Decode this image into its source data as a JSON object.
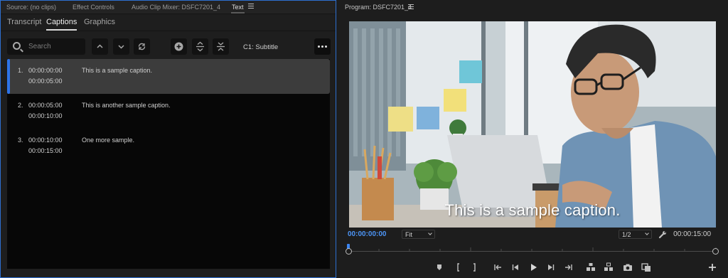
{
  "left_panel": {
    "tabs": [
      {
        "label": "Source: (no clips)"
      },
      {
        "label": "Effect Controls"
      },
      {
        "label": "Audio Clip Mixer: DSFC7201_4"
      },
      {
        "label": "Text"
      }
    ],
    "active_tab": "Text",
    "sub_tabs": [
      {
        "label": "Transcript"
      },
      {
        "label": "Captions"
      },
      {
        "label": "Graphics"
      }
    ],
    "active_sub_tab": "Captions",
    "search": {
      "placeholder": "Search",
      "value": ""
    },
    "track_label": "C1: Subtitle",
    "captions": [
      {
        "num": "1.",
        "in": "00:00:00:00",
        "out": "00:00:05:00",
        "text": "This is a sample caption.",
        "selected": true
      },
      {
        "num": "2.",
        "in": "00:00:05:00",
        "out": "00:00:10:00",
        "text": "This is another sample caption.",
        "selected": false
      },
      {
        "num": "3.",
        "in": "00:00:10:00",
        "out": "00:00:15:00",
        "text": "One more sample.",
        "selected": false
      }
    ]
  },
  "program": {
    "title": "Program: DSFC7201_4",
    "caption_overlay": "This is a sample caption.",
    "current_timecode": "00:00:00:00",
    "zoom": "Fit",
    "resolution": "1/2",
    "duration_timecode": "00:00:15:00",
    "playhead_fraction": 0.0
  },
  "colors": {
    "accent_blue": "#2d73e8",
    "timecode_blue": "#4c94f5",
    "panel_bg": "#1e1e1e",
    "list_bg": "#070707",
    "selected_row": "#3c3c3c"
  }
}
